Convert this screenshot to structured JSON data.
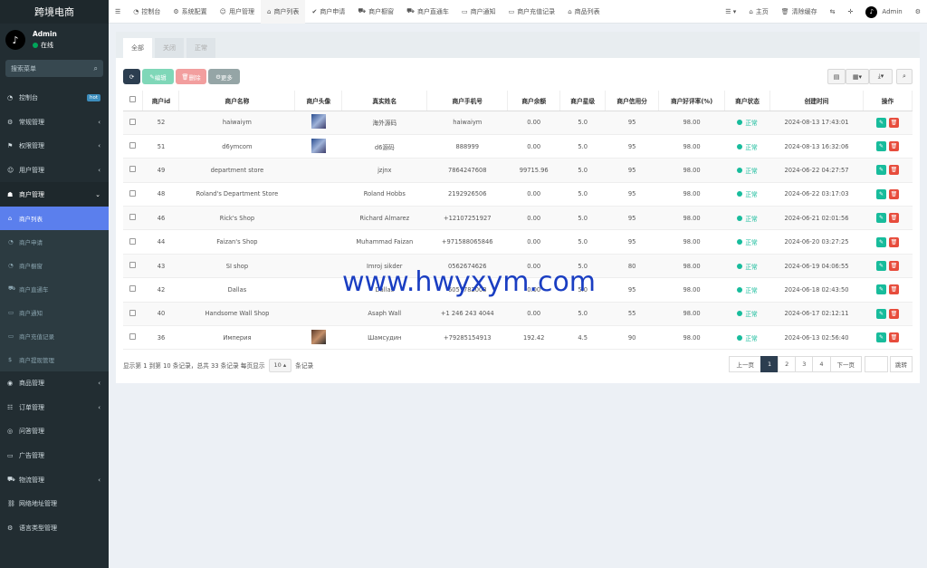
{
  "brand": "跨境电商",
  "user": {
    "name": "Admin",
    "status": "在线"
  },
  "search": {
    "placeholder": "搜索菜单"
  },
  "sidebar": {
    "items": [
      {
        "label": "控制台",
        "badge": "hot"
      },
      {
        "label": "常规管理"
      },
      {
        "label": "权限管理"
      },
      {
        "label": "用户管理"
      },
      {
        "label": "商户管理"
      }
    ],
    "submenu": [
      {
        "label": "商户列表"
      },
      {
        "label": "商户申请"
      },
      {
        "label": "商户橱窗"
      },
      {
        "label": "商户直通车"
      },
      {
        "label": "商户通知"
      },
      {
        "label": "商户充值记录"
      },
      {
        "label": "商户提现管理"
      }
    ],
    "items_after": [
      {
        "label": "商品管理"
      },
      {
        "label": "订单管理"
      },
      {
        "label": "问答管理"
      },
      {
        "label": "广告管理"
      },
      {
        "label": "物流管理"
      },
      {
        "label": "网络地址管理"
      },
      {
        "label": "语言类型管理"
      }
    ]
  },
  "topbar": {
    "tabs": [
      "控制台",
      "系统配置",
      "用户管理",
      "商户列表",
      "商户申请",
      "商户橱窗",
      "商户直通车",
      "商户通知",
      "商户充值记录",
      "商品列表"
    ],
    "home": "主页",
    "clear_cache": "清除缓存",
    "user": "Admin"
  },
  "panel_tabs": [
    "全部",
    "关闭",
    "正常"
  ],
  "toolbar": {
    "edit": "编辑",
    "delete": "删除",
    "more": "更多"
  },
  "table": {
    "headers": [
      "商户id",
      "商户名称",
      "商户头像",
      "真实姓名",
      "商户手机号",
      "商户余额",
      "商户星级",
      "商户信用分",
      "商户好评率(%)",
      "商户状态",
      "创建时间",
      "操作"
    ],
    "rows": [
      {
        "id": "52",
        "name": "haiwaiym",
        "avatar": true,
        "realname": "海外源码",
        "phone": "haiwaiym",
        "balance": "0.00",
        "star": "5.0",
        "credit": "95",
        "rate": "98.00",
        "status": "正常",
        "created": "2024-08-13 17:43:01"
      },
      {
        "id": "51",
        "name": "d6ymcom",
        "avatar": true,
        "realname": "d6源码",
        "phone": "888999",
        "balance": "0.00",
        "star": "5.0",
        "credit": "95",
        "rate": "98.00",
        "status": "正常",
        "created": "2024-08-13 16:32:06"
      },
      {
        "id": "49",
        "name": "department store",
        "avatar": false,
        "realname": "jzjnx",
        "phone": "7864247608",
        "balance": "99715.96",
        "star": "5.0",
        "credit": "95",
        "rate": "98.00",
        "status": "正常",
        "created": "2024-06-22 04:27:57"
      },
      {
        "id": "48",
        "name": "Roland's Department Store",
        "avatar": false,
        "realname": "Roland Hobbs",
        "phone": "2192926506",
        "balance": "0.00",
        "star": "5.0",
        "credit": "95",
        "rate": "98.00",
        "status": "正常",
        "created": "2024-06-22 03:17:03"
      },
      {
        "id": "46",
        "name": "Rick's Shop",
        "avatar": false,
        "realname": "Richard Almarez",
        "phone": "+12107251927",
        "balance": "0.00",
        "star": "5.0",
        "credit": "95",
        "rate": "98.00",
        "status": "正常",
        "created": "2024-06-21 02:01:56"
      },
      {
        "id": "44",
        "name": "Faizan's Shop",
        "avatar": false,
        "realname": "Muhammad Faizan",
        "phone": "+971588065846",
        "balance": "0.00",
        "star": "5.0",
        "credit": "95",
        "rate": "98.00",
        "status": "正常",
        "created": "2024-06-20 03:27:25"
      },
      {
        "id": "43",
        "name": "SI shop",
        "avatar": false,
        "realname": "Imroj sikder",
        "phone": "0562674626",
        "balance": "0.00",
        "star": "5.0",
        "credit": "80",
        "rate": "98.00",
        "status": "正常",
        "created": "2024-06-19 04:06:55"
      },
      {
        "id": "42",
        "name": "Dallas",
        "avatar": false,
        "realname": "Dallas",
        "phone": "6057782008",
        "balance": "0.00",
        "star": "5.0",
        "credit": "95",
        "rate": "98.00",
        "status": "正常",
        "created": "2024-06-18 02:43:50"
      },
      {
        "id": "40",
        "name": "Handsome Wall Shop",
        "avatar": false,
        "realname": "Asaph Wall",
        "phone": "+1 246 243 4044",
        "balance": "0.00",
        "star": "5.0",
        "credit": "55",
        "rate": "98.00",
        "status": "正常",
        "created": "2024-06-17 02:12:11"
      },
      {
        "id": "36",
        "name": "Империя",
        "avatar": true,
        "realname": "Шамсудин",
        "phone": "+79285154913",
        "balance": "192.42",
        "star": "4.5",
        "credit": "90",
        "rate": "98.00",
        "status": "正常",
        "created": "2024-06-13 02:56:40"
      }
    ]
  },
  "footer": {
    "text_before": "显示第 1 到第 10 条记录，总共 33 条记录 每页显示",
    "page_size": "10",
    "text_after": "条记录"
  },
  "pager": {
    "prev": "上一页",
    "pages": [
      "1",
      "2",
      "3",
      "4"
    ],
    "next": "下一页",
    "jump": "跳转"
  },
  "watermark": "www.hwyxym.com"
}
